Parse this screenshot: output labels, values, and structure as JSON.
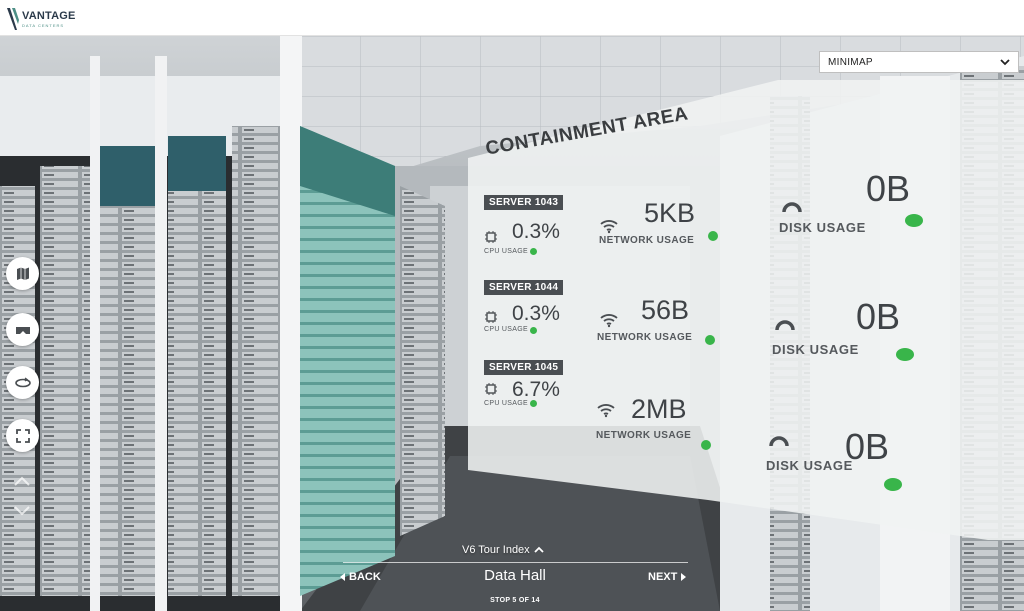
{
  "header": {
    "logo_name": "VANTAGE",
    "logo_sub": "DATA CENTERS"
  },
  "minimap": {
    "label": "MINIMAP"
  },
  "sidebar": {
    "buttons": [
      {
        "name": "map-icon"
      },
      {
        "name": "vr-headset-icon"
      },
      {
        "name": "rotate-360-icon"
      },
      {
        "name": "fullscreen-icon"
      }
    ]
  },
  "panel": {
    "title": "CONTAINMENT AREA",
    "servers": [
      {
        "name": "SERVER 1043",
        "cpu": "0.3%",
        "cpu_label": "CPU USAGE",
        "network": "5KB",
        "network_label": "NETWORK USAGE",
        "disk": "0B",
        "disk_label": "DISK USAGE"
      },
      {
        "name": "SERVER 1044",
        "cpu": "0.3%",
        "cpu_label": "CPU USAGE",
        "network": "56B",
        "network_label": "NETWORK USAGE",
        "disk": "0B",
        "disk_label": "DISK USAGE"
      },
      {
        "name": "SERVER 1045",
        "cpu": "6.7%",
        "cpu_label": "CPU USAGE",
        "network": "2MB",
        "network_label": "NETWORK USAGE",
        "disk": "0B",
        "disk_label": "DISK USAGE"
      }
    ],
    "status_color": "#39b54a"
  },
  "tour": {
    "index_label": "V6 Tour Index",
    "back_label": "BACK",
    "next_label": "NEXT",
    "stop_title": "Data Hall",
    "stop_count": "STOP 5 OF 14"
  }
}
